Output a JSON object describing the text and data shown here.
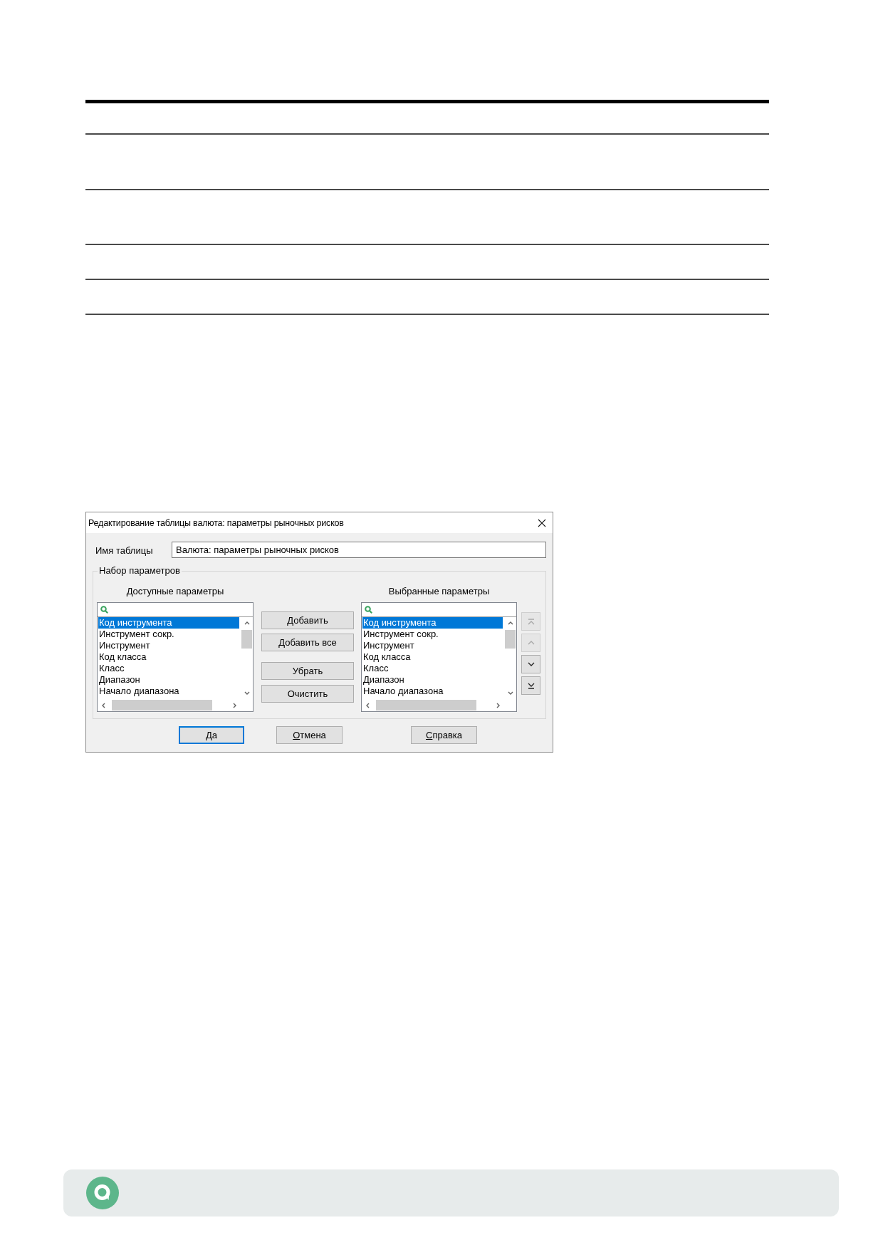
{
  "dialog": {
    "title": "Редактирование таблицы валюта: параметры рыночных рисков",
    "table_name": {
      "label": "Имя таблицы",
      "value": "Валюта: параметры рыночных рисков"
    },
    "parameter_set": {
      "title": "Набор параметров",
      "available": {
        "heading": "Доступные параметры",
        "items": [
          {
            "label": "Код инструмента",
            "selected": true
          },
          {
            "label": "Инструмент сокр.",
            "selected": false
          },
          {
            "label": "Инструмент",
            "selected": false
          },
          {
            "label": "Код класса",
            "selected": false
          },
          {
            "label": "Класс",
            "selected": false
          },
          {
            "label": "Диапазон",
            "selected": false
          },
          {
            "label": "Начало диапазона",
            "selected": false
          }
        ]
      },
      "transfer_buttons": [
        {
          "label": "Добавить"
        },
        {
          "label": "Добавить все"
        },
        {
          "label": "Убрать"
        },
        {
          "label": "Очистить"
        }
      ],
      "chosen": {
        "heading": "Выбранные параметры",
        "items": [
          {
            "label": "Код инструмента",
            "selected": true
          },
          {
            "label": "Инструмент сокр.",
            "selected": false
          },
          {
            "label": "Инструмент",
            "selected": false
          },
          {
            "label": "Код класса",
            "selected": false
          },
          {
            "label": "Класс",
            "selected": false
          },
          {
            "label": "Диапазон",
            "selected": false
          },
          {
            "label": "Начало диапазона",
            "selected": false
          }
        ]
      },
      "order_buttons": [
        {
          "kind": "top",
          "disabled": true
        },
        {
          "kind": "up",
          "disabled": true
        },
        {
          "kind": "down",
          "disabled": false
        },
        {
          "kind": "bottom",
          "disabled": false
        }
      ]
    },
    "buttons": [
      {
        "label": "Да",
        "default": true
      },
      {
        "label": "Отмена",
        "default": false
      },
      {
        "label": "Справка",
        "default": false
      }
    ]
  }
}
